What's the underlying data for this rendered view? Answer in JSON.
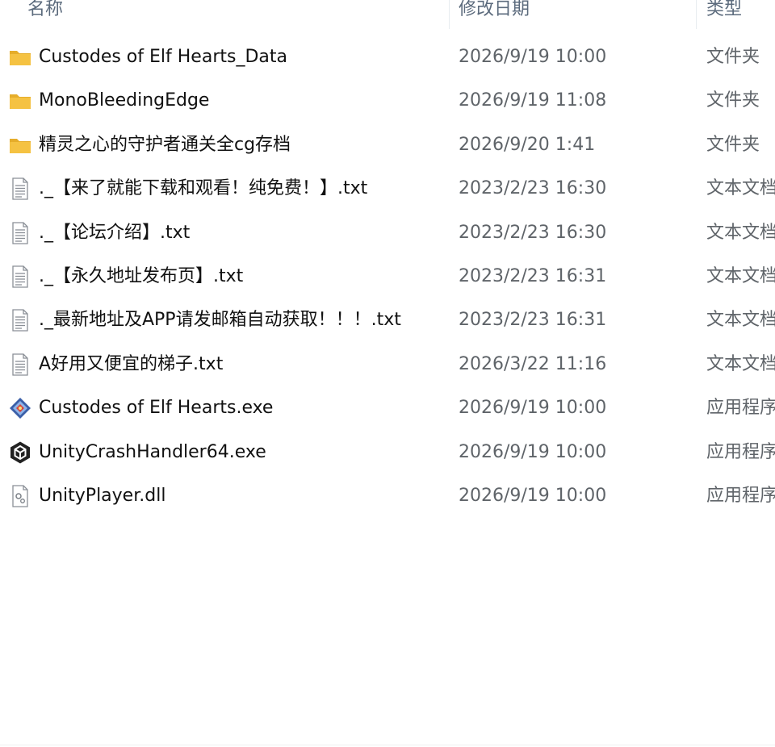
{
  "columns": {
    "name": "名称",
    "date": "修改日期",
    "type": "类型"
  },
  "files": [
    {
      "icon": "folder-icon",
      "name": "Custodes of Elf Hearts_Data",
      "date": "2026/9/19 10:00",
      "type": "文件夹"
    },
    {
      "icon": "folder-icon",
      "name": "MonoBleedingEdge",
      "date": "2026/9/19 11:08",
      "type": "文件夹"
    },
    {
      "icon": "folder-icon",
      "name": "精灵之心的守护者通关全cg存档",
      "date": "2026/9/20 1:41",
      "type": "文件夹"
    },
    {
      "icon": "text-file-icon",
      "name": "._【来了就能下载和观看！纯免费！】.txt",
      "date": "2023/2/23 16:30",
      "type": "文本文档"
    },
    {
      "icon": "text-file-icon",
      "name": "._【论坛介绍】.txt",
      "date": "2023/2/23 16:30",
      "type": "文本文档"
    },
    {
      "icon": "text-file-icon",
      "name": "._【永久地址发布页】.txt",
      "date": "2023/2/23 16:31",
      "type": "文本文档"
    },
    {
      "icon": "text-file-icon",
      "name": "._最新地址及APP请发邮箱自动获取！！！.txt",
      "date": "2023/2/23 16:31",
      "type": "文本文档"
    },
    {
      "icon": "text-file-icon",
      "name": "A好用又便宜的梯子.txt",
      "date": "2026/3/22 11:16",
      "type": "文本文档"
    },
    {
      "icon": "game-exe-icon",
      "name": "Custodes of Elf Hearts.exe",
      "date": "2026/9/19 10:00",
      "type": "应用程序"
    },
    {
      "icon": "unity-icon",
      "name": "UnityCrashHandler64.exe",
      "date": "2026/9/19 10:00",
      "type": "应用程序"
    },
    {
      "icon": "dll-file-icon",
      "name": "UnityPlayer.dll",
      "date": "2026/9/19 10:00",
      "type": "应用程序扩展"
    }
  ],
  "colors": {
    "folder": "#f5c242",
    "folder_tab": "#e6ad2a",
    "header_text": "#5c6b7d",
    "date_text": "#5f6469"
  }
}
